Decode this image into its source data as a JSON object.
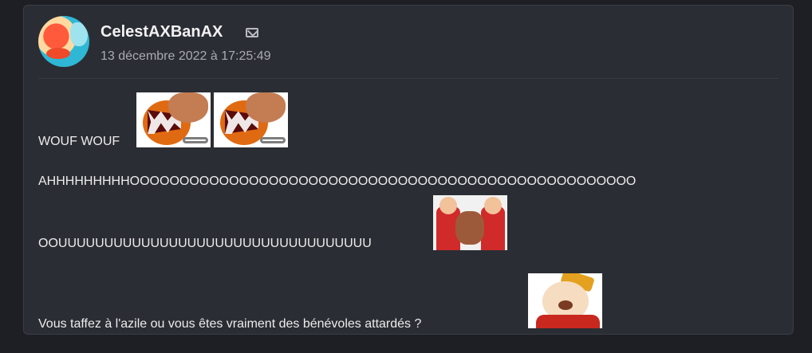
{
  "post": {
    "author": "CelestAXBanAX",
    "date": "13 décembre 2022 à 17:25:49",
    "lines": {
      "l1": "WOUF WOUF",
      "l2": "AHHHHHHHHHOOOOOOOOOOOOOOOOOOOOOOOOOOOOOOOOOOOOOOOOOOOOOOOOOOO",
      "l3": "OOUUUUUUUUUUUUUUUUUUUUUUUUUUUUUUUUUU",
      "l4": "Vous taffez à l'azile ou vous êtes vraiment des bénévoles attardés ?"
    }
  },
  "icons": {
    "mail": "mail-icon",
    "avatar": "user-avatar",
    "stickers": [
      "chomp-sticker",
      "chomp-sticker",
      "grooms-sticker",
      "spirou-sticker"
    ]
  }
}
